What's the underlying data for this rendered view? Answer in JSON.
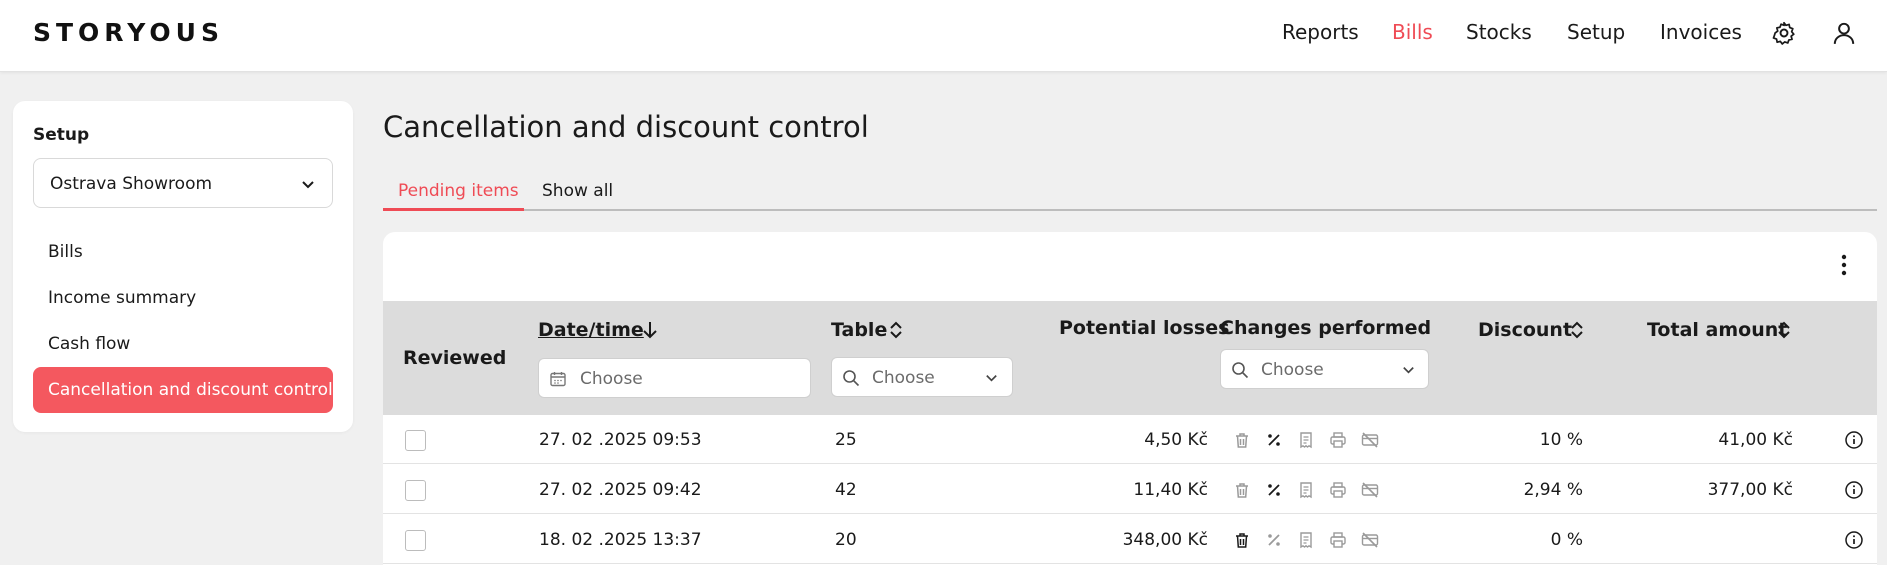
{
  "header": {
    "logo": "STORYOUS",
    "nav": [
      "Reports",
      "Bills",
      "Stocks",
      "Setup",
      "Invoices"
    ],
    "active_nav": "Bills",
    "icons": [
      "gear-icon",
      "user-icon"
    ]
  },
  "sidebar": {
    "title": "Setup",
    "location": "Ostrava Showroom",
    "items": [
      "Bills",
      "Income summary",
      "Cash flow",
      "Cancellation and discount control"
    ],
    "active_item": "Cancellation and discount control"
  },
  "main": {
    "title": "Cancellation and discount control",
    "tabs": [
      "Pending items",
      "Show all"
    ],
    "active_tab": "Pending items"
  },
  "table": {
    "columns": {
      "reviewed": "Reviewed",
      "datetime": "Date/time",
      "table": "Table",
      "losses": "Potential losses",
      "changes": "Changes performed",
      "discount": "Discount",
      "total": "Total amount"
    },
    "filters": {
      "datetime_placeholder": "Choose",
      "table_placeholder": "Choose",
      "changes_placeholder": "Choose"
    },
    "rows": [
      {
        "datetime": "27. 02 .2025 09:53",
        "table": "25",
        "losses": "4,50 Kč",
        "discount": "10 %",
        "total": "41,00 Kč",
        "active_change": "discount"
      },
      {
        "datetime": "27. 02 .2025 09:42",
        "table": "42",
        "losses": "11,40 Kč",
        "discount": "2,94 %",
        "total": "377,00 Kč",
        "active_change": "discount"
      },
      {
        "datetime": "18. 02 .2025 13:37",
        "table": "20",
        "losses": "348,00 Kč",
        "discount": "0 %",
        "total": "",
        "active_change": "cancel"
      }
    ]
  },
  "colors": {
    "accent": "#ef4b55",
    "active_bg": "#f4585f"
  }
}
